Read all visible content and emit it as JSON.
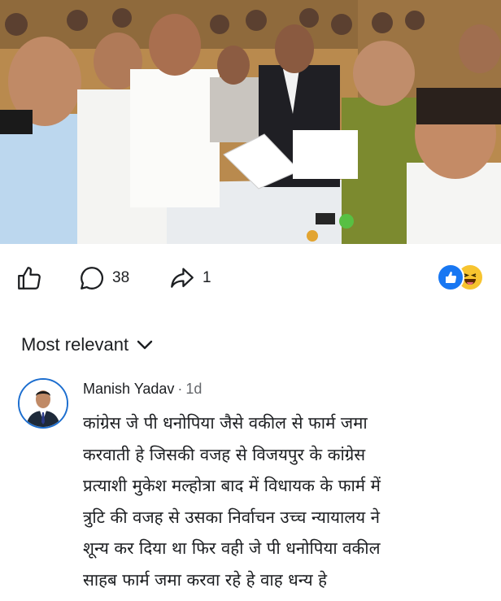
{
  "post": {
    "photo_description_icon": "group-photo",
    "actions": {
      "like_icon": "thumbs-up-icon",
      "comment_icon": "comment-bubble-icon",
      "comment_count": "38",
      "share_icon": "share-arrow-icon",
      "share_count": "1"
    },
    "reactions": [
      "like",
      "haha"
    ]
  },
  "comments": {
    "sort_label": "Most relevant",
    "items": [
      {
        "author": "Manish Yadav",
        "separator": "·",
        "time": "1d",
        "lines": [
          "कांग्रेस जे पी धनोपिया जैसे वकील से फार्म जमा",
          "करवाती हे जिसकी वजह से विजयपुर के कांग्रेस",
          "प्रत्याशी मुकेश मल्होत्रा  बाद में विधायक के फार्म में",
          "त्रुटि की वजह से उसका निर्वाचन उच्च न्यायालय ने",
          "शून्य कर दिया था फिर वही जे पी धनोपिया वकील",
          "साहब फार्म जमा करवा रहे हे वाह धन्य हे"
        ]
      }
    ]
  },
  "colors": {
    "accent": "#1877f2",
    "muted": "#65676b",
    "text": "#1c1e21"
  }
}
